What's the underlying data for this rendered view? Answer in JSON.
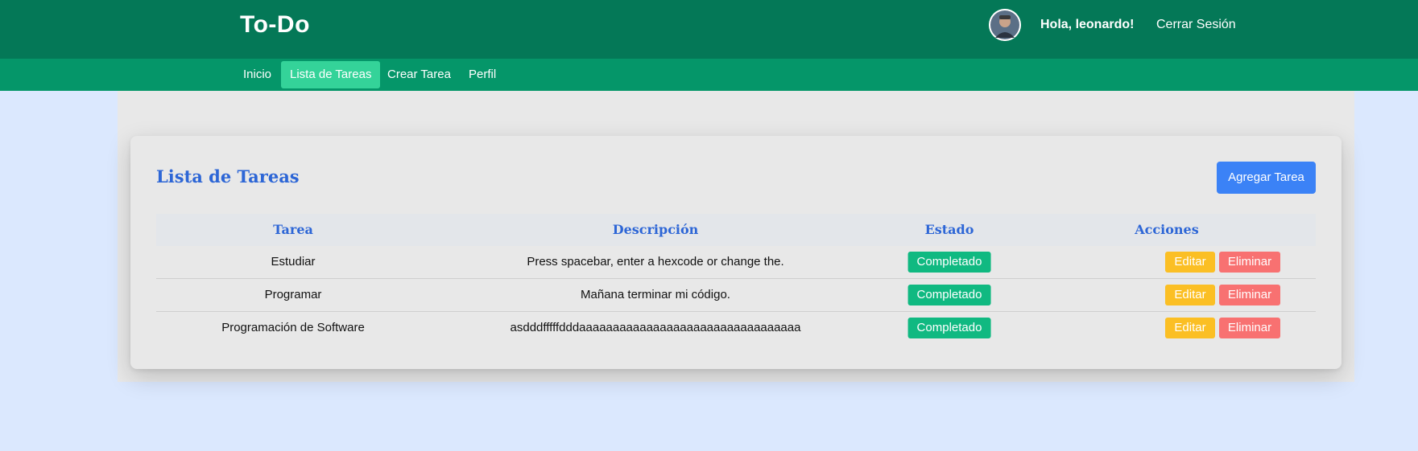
{
  "header": {
    "app_title": "To-Do",
    "greeting": "Hola, leonardo!",
    "logout_label": "Cerrar Sesión",
    "avatar_icon": "user-avatar"
  },
  "nav": {
    "items": [
      {
        "label": "Inicio",
        "active": false
      },
      {
        "label": "Lista de Tareas",
        "active": true
      },
      {
        "label": "Crear Tarea",
        "active": false
      },
      {
        "label": "Perfil",
        "active": false
      }
    ]
  },
  "main": {
    "title": "Lista de Tareas",
    "add_button_label": "Agregar Tarea",
    "table": {
      "columns": [
        "Tarea",
        "Descripción",
        "Estado",
        "Acciones"
      ],
      "rows": [
        {
          "task": "Estudiar",
          "description": "Press spacebar, enter a hexcode or change the.",
          "status": "Completado",
          "edit_label": "Editar",
          "delete_label": "Eliminar"
        },
        {
          "task": "Programar",
          "description": "Mañana terminar mi código.",
          "status": "Completado",
          "edit_label": "Editar",
          "delete_label": "Eliminar"
        },
        {
          "task": "Programación de Software",
          "description": "asdddfffffdddaaaaaaaaaaaaaaaaaaaaaaaaaaaaaaaaa",
          "status": "Completado",
          "edit_label": "Editar",
          "delete_label": "Eliminar"
        }
      ]
    }
  },
  "colors": {
    "header_bg": "#047857",
    "nav_bg": "#059669",
    "nav_active_bg": "#34d399",
    "page_bg": "#dbe8fe",
    "title_blue": "#2d66d6",
    "add_button": "#3b82f6",
    "status_badge": "#10b981",
    "edit_button": "#fbbf24",
    "delete_button": "#f87171"
  }
}
